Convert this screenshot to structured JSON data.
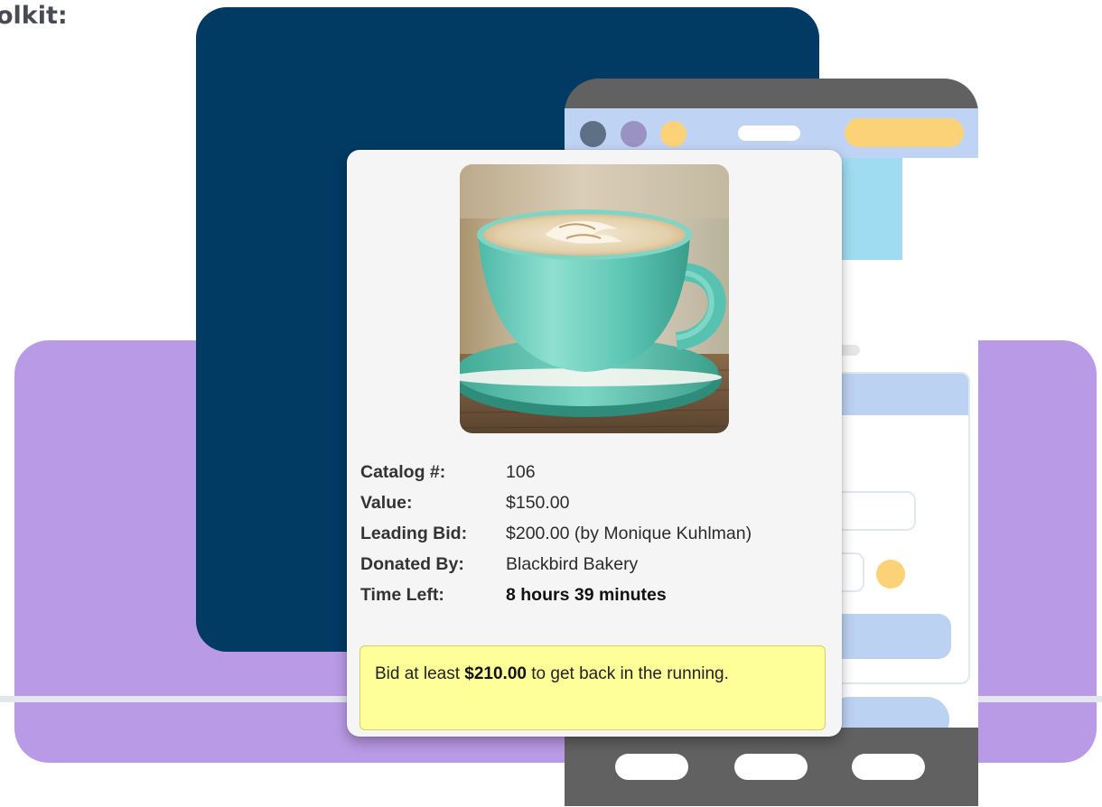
{
  "heading_fragment": "olkit:",
  "phone": {
    "nav_buttons": [
      "",
      "",
      ""
    ]
  },
  "item": {
    "photo": "latte-art-cup-photo",
    "details": [
      {
        "label": "Catalog #:",
        "value": "106"
      },
      {
        "label": "Value:",
        "value": "$150.00"
      },
      {
        "label": "Leading Bid:",
        "value": "$200.00 (by Monique Kuhlman)"
      },
      {
        "label": "Donated By:",
        "value": "Blackbird Bakery"
      },
      {
        "label": "Time Left:",
        "value": "8 hours 39 minutes"
      }
    ],
    "bid_note": {
      "prefix": "Bid at least ",
      "amount": "$210.00",
      "suffix": " to get back in the running."
    }
  },
  "colors": {
    "navy": "#013a63",
    "purple": "#b99ae6",
    "phone_frame": "#616161",
    "phone_header": "#bfd3f4",
    "accent_yellow": "#fcd279",
    "note_yellow": "#ffff99"
  }
}
